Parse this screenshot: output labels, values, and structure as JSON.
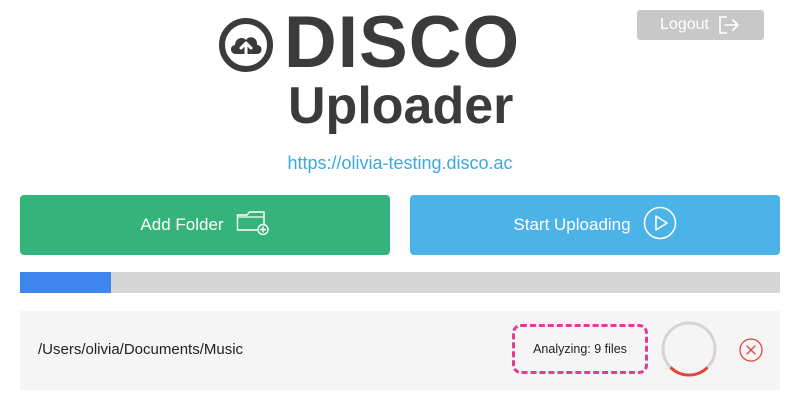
{
  "header": {
    "logout_label": "Logout"
  },
  "logo": {
    "brand": "DISCO",
    "subtitle": "Uploader",
    "icon": "cloud-upload-icon"
  },
  "site_url": "https://olivia-testing.disco.ac",
  "actions": {
    "add_folder_label": "Add Folder",
    "add_folder_icon": "folder-add-icon",
    "start_uploading_label": "Start Uploading",
    "start_uploading_icon": "play-circle-icon"
  },
  "upload_progress": {
    "fraction": 0.12,
    "color": "#3f86ec"
  },
  "folders": [
    {
      "path": "/Users/olivia/Documents/Music",
      "status": "Analyzing: 9 files",
      "spinner_progress": 0.25,
      "remove_icon": "close-circle-icon"
    }
  ],
  "colors": {
    "green": "#34b47b",
    "blue": "#4bb3e8",
    "link": "#3da8df",
    "highlight": "#e23b92",
    "danger": "#e0463c"
  }
}
